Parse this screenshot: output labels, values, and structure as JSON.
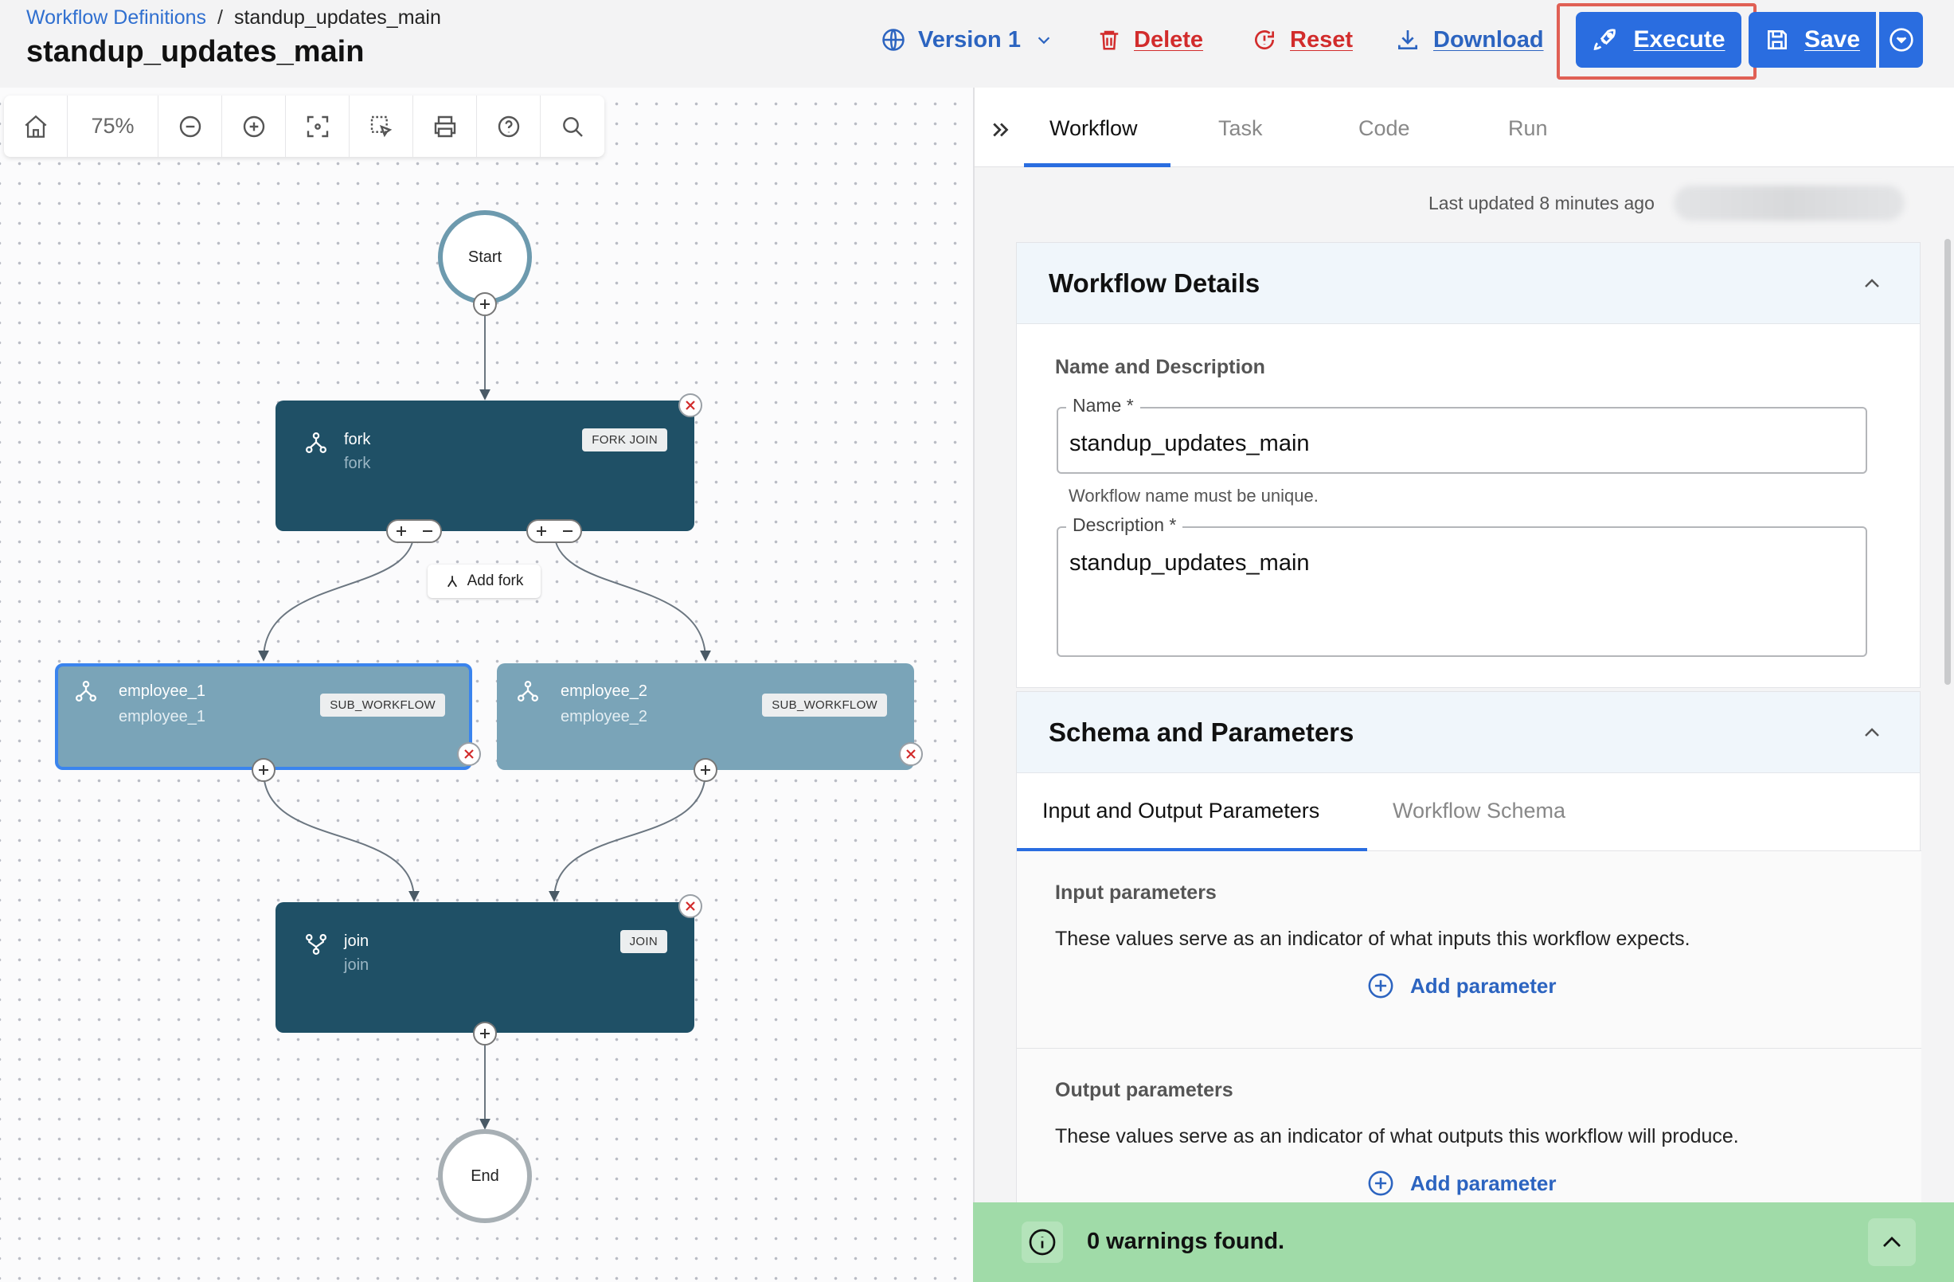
{
  "breadcrumb": {
    "root": "Workflow Definitions",
    "separator": "/",
    "current": "standup_updates_main"
  },
  "page_title": "standup_updates_main",
  "header_actions": {
    "version": "Version 1",
    "delete": "Delete",
    "reset": "Reset",
    "download": "Download",
    "execute": "Execute",
    "save": "Save"
  },
  "toolbar": {
    "zoom": "75%"
  },
  "diagram": {
    "start": "Start",
    "end": "End",
    "fork": {
      "name": "fork",
      "ref": "fork",
      "type": "FORK JOIN",
      "add_fork": "Add fork"
    },
    "employee_1": {
      "name": "employee_1",
      "ref": "employee_1",
      "type": "SUB_WORKFLOW"
    },
    "employee_2": {
      "name": "employee_2",
      "ref": "employee_2",
      "type": "SUB_WORKFLOW"
    },
    "join": {
      "name": "join",
      "ref": "join",
      "type": "JOIN"
    }
  },
  "panel": {
    "tabs": [
      "Workflow",
      "Task",
      "Code",
      "Run"
    ],
    "last_updated": "Last updated 8 minutes ago",
    "workflow_details": {
      "title": "Workflow Details",
      "section": "Name and Description",
      "name_label": "Name *",
      "name_value": "standup_updates_main",
      "name_helper": "Workflow name must be unique.",
      "description_label": "Description *",
      "description_value": "standup_updates_main"
    },
    "schema": {
      "title": "Schema and Parameters",
      "subtabs": [
        "Input and Output Parameters",
        "Workflow Schema"
      ],
      "input_title": "Input parameters",
      "input_desc": "These values serve as an indicator of what inputs this workflow expects.",
      "output_title": "Output parameters",
      "output_desc": "These values serve as an indicator of what outputs this workflow will produce.",
      "add_parameter": "Add parameter"
    }
  },
  "warnings": "0 warnings found.",
  "colors": {
    "accent": "#2a6de0",
    "danger": "#d22c2c",
    "node_dark": "#1f5066",
    "node_light": "#7aa4b8",
    "warning_bar": "#a0dba8"
  }
}
